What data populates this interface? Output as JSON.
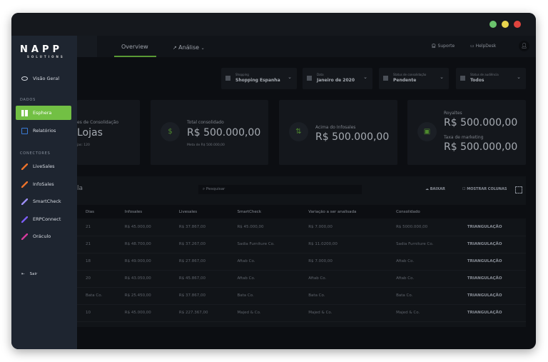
{
  "window": {
    "dots": {
      "green": "#6bc46d",
      "yellow": "#e8d44d",
      "red": "#e0443e"
    }
  },
  "sidebar": {
    "logo": "NAPP",
    "logo_sub": "SOLUTIONS",
    "overview": "Visão Geral",
    "section_dados": "DADOS",
    "dados": [
      {
        "label": "Esphera",
        "icon": "grid-icon",
        "active": true
      },
      {
        "label": "Relatórios",
        "icon": "clipboard-icon"
      }
    ],
    "section_conectores": "CONECTORES",
    "conectores": [
      {
        "label": "LiveSales",
        "color": "#e8702a"
      },
      {
        "label": "InfoSales",
        "color": "#e8702a"
      },
      {
        "label": "SmartCheck",
        "color": "#9a8cf0"
      },
      {
        "label": "ERPConnect",
        "color": "#7a5cf0"
      },
      {
        "label": "Oráculo",
        "color": "#d03a9a"
      }
    ],
    "logout": "Sair"
  },
  "header": {
    "tabs": [
      {
        "label": "Overview",
        "active": true
      },
      {
        "label": "Análise"
      }
    ],
    "support": "Suporte",
    "helpdesk": "HelpDesk"
  },
  "filters": [
    {
      "label": "Shopping",
      "value": "Shopping Espanha"
    },
    {
      "label": "Data",
      "value": "Janeiro de 2020"
    },
    {
      "label": "Status de consolidação",
      "value": "Pendente"
    },
    {
      "label": "Status de audiência",
      "value": "Todos"
    }
  ],
  "cards": {
    "c1": {
      "label": "es de Consolidação",
      "value": "Lojas",
      "sub": "jas: 120"
    },
    "c2": {
      "label": "Total consolidado",
      "value": "R$ 500.000,00",
      "sub": "Meta de R$ 500.000,00"
    },
    "c3": {
      "label": "Acima do Infosales",
      "value": "R$ 500.000,00"
    },
    "c4": {
      "label": "Royaltes",
      "value": "R$ 500.000,00",
      "label2": "Taxa de marketing",
      "value2": "R$ 500.000,00"
    }
  },
  "table": {
    "title": "la",
    "search_placeholder": "Pesquisar",
    "download": "BAIXAR",
    "show_columns": "MOSTRAR COLUNAS",
    "columns": [
      "Dias",
      "Infosales",
      "Livesales",
      "SmartCheck",
      "Variação a ser analisada",
      "Consolidado",
      ""
    ],
    "rows": [
      [
        "21",
        "R$ 45.000,00",
        "R$ 37.867,00",
        "R$ 45.000,00",
        "R$ 7.000,00",
        "R$ 5000.000,00",
        "TRIANGULAÇÃO"
      ],
      [
        "21",
        "R$ 48.700,00",
        "R$ 37.267,00",
        "Sadia Furniture Co.",
        "R$ 11.0200,00",
        "Sadia Furniture Co.",
        "TRIANGULAÇÃO"
      ],
      [
        "18",
        "R$ 49.000,00",
        "R$ 27.867,00",
        "Aftab Co.",
        "R$ 7.000,00",
        "Aftab Co.",
        "TRIANGULAÇÃO"
      ],
      [
        "20",
        "R$ 43.050,00",
        "R$ 45.867,00",
        "Aftab Co.",
        "Aftab Co.",
        "Aftab Co.",
        "TRIANGULAÇÃO"
      ],
      [
        "Bata Co.",
        "R$ 25.450,00",
        "R$ 37.867,00",
        "Bata Co.",
        "Bata Co.",
        "Bata Co.",
        "TRIANGULAÇÃO"
      ],
      [
        "10",
        "R$ 45.000,00",
        "R$ 227.367,00",
        "Majed & Co.",
        "Majed & Co.",
        "Majed & Co.",
        "TRIANGULAÇÃO"
      ]
    ]
  }
}
